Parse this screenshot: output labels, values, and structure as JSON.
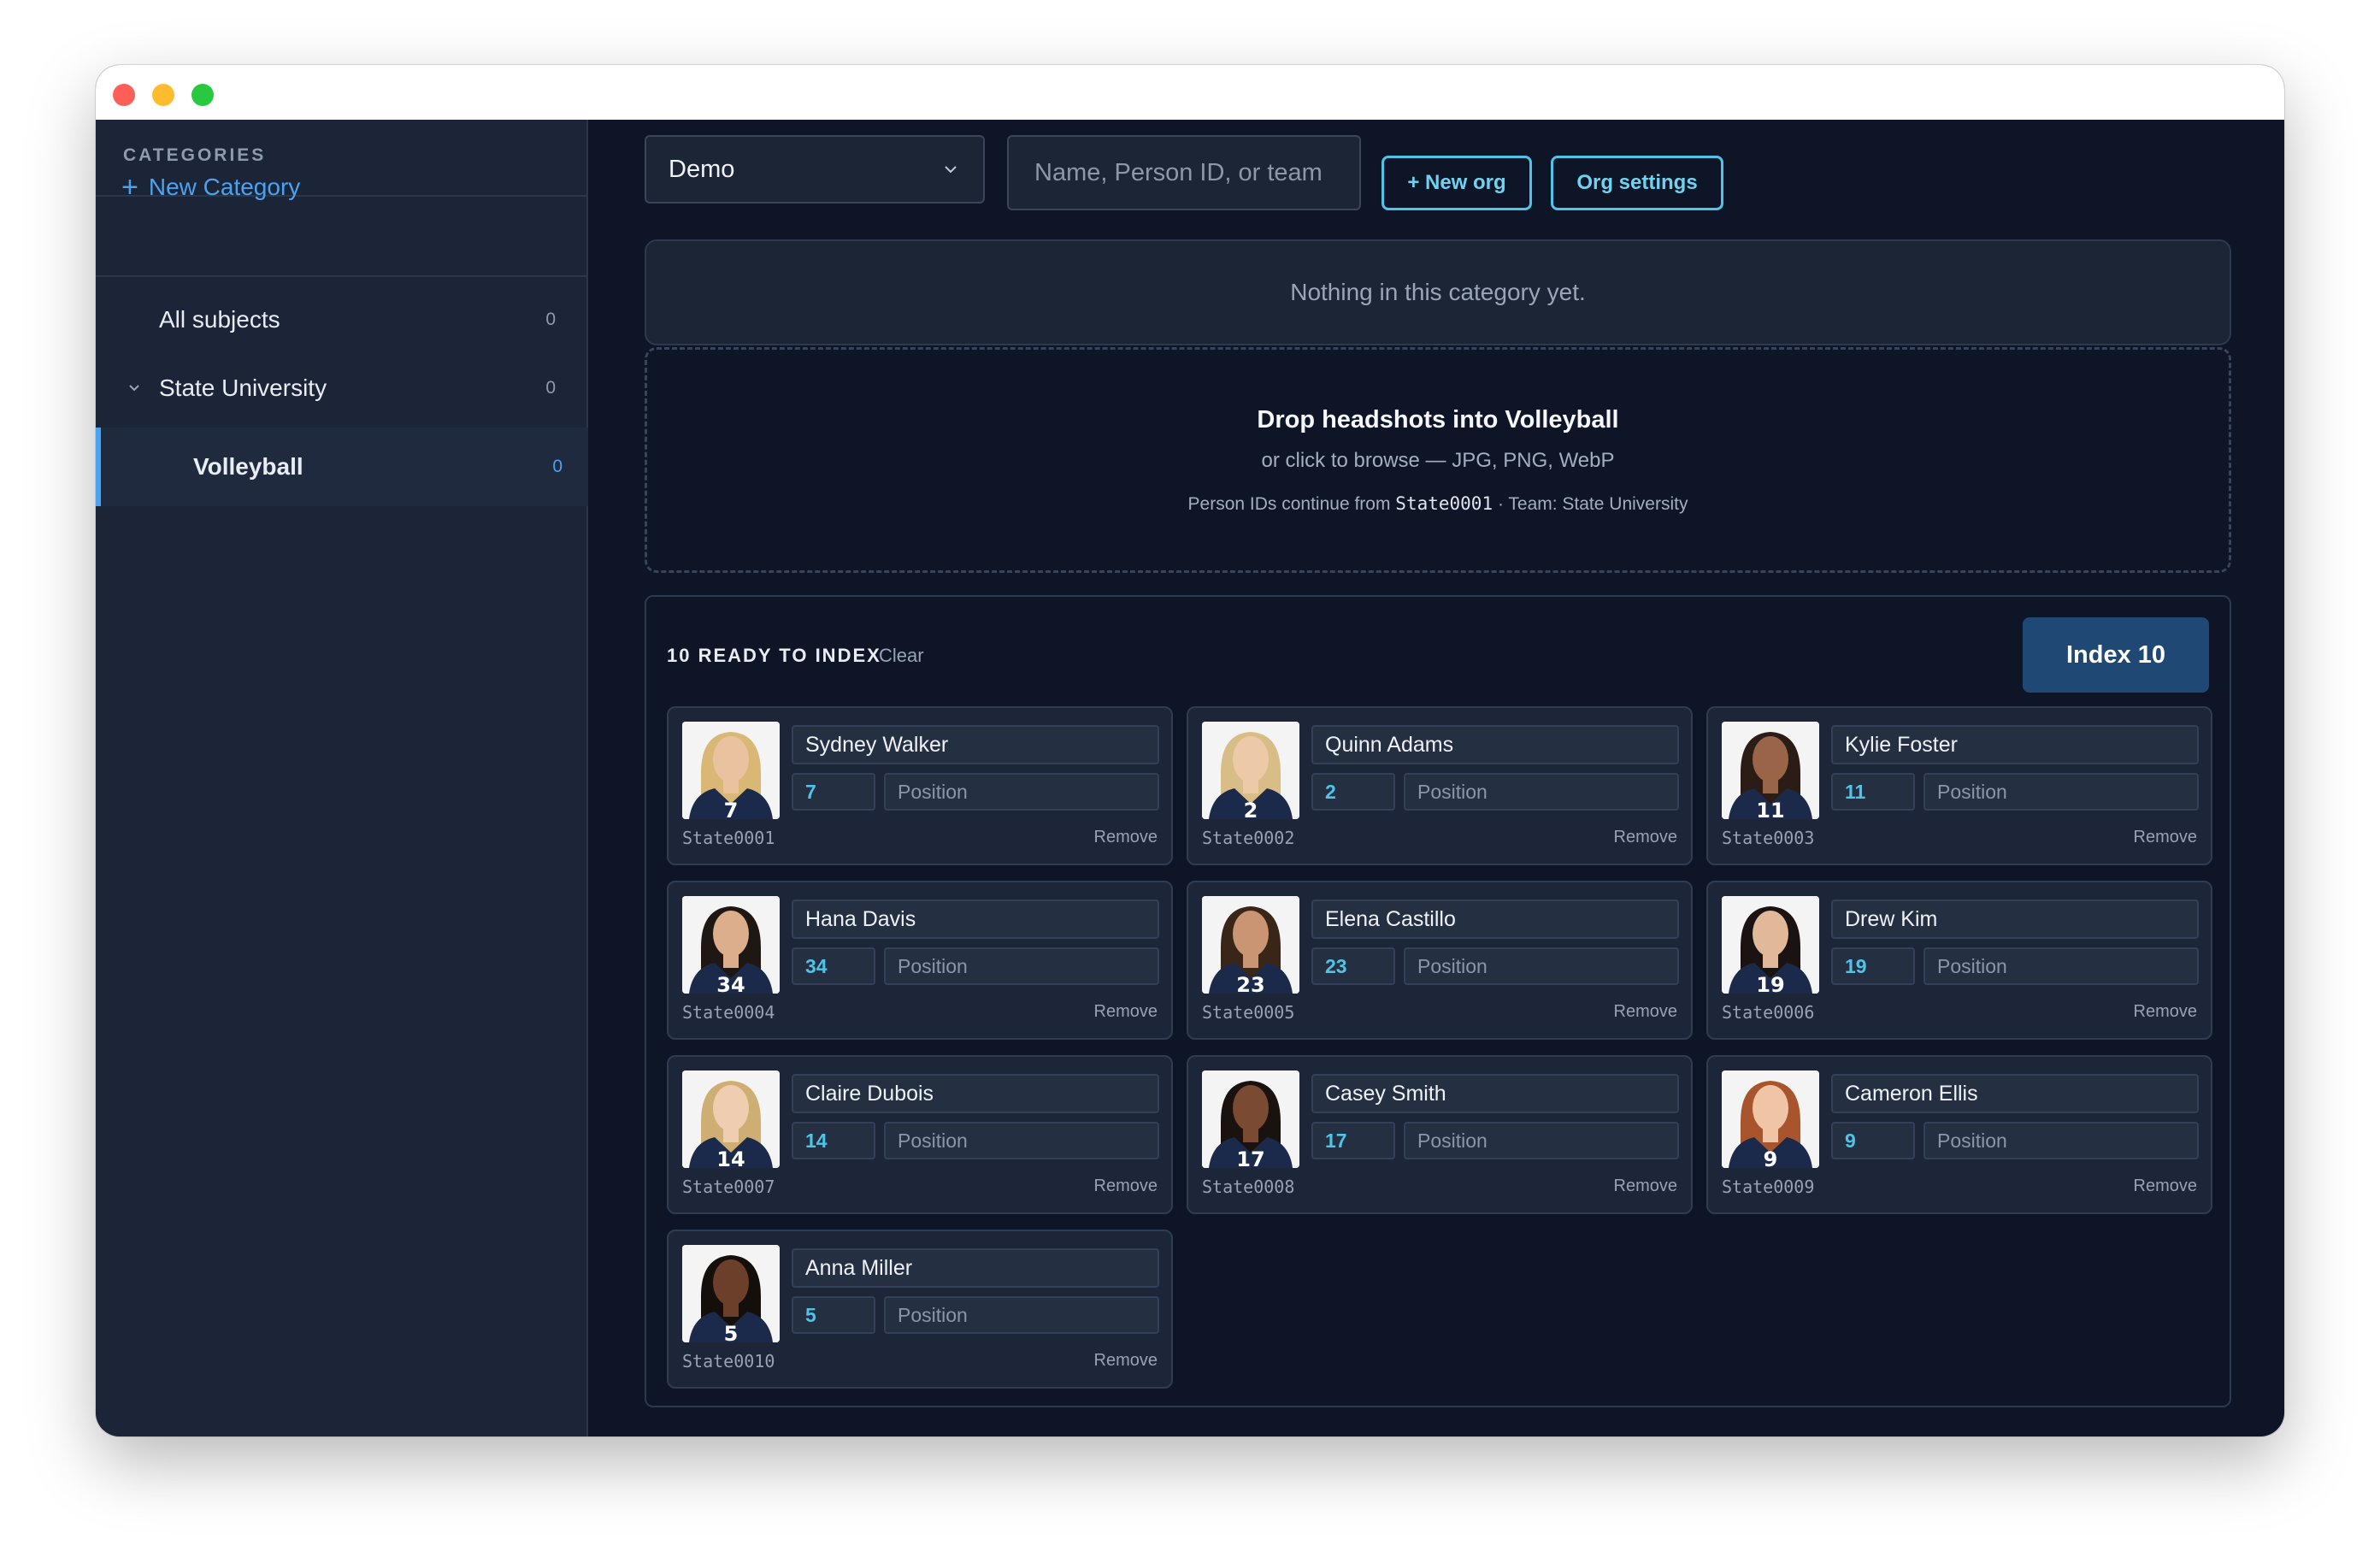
{
  "sidebar": {
    "heading": "CATEGORIES",
    "new_category": "New Category",
    "items": [
      {
        "label": "All subjects",
        "count": "0"
      },
      {
        "label": "State University",
        "count": "0"
      },
      {
        "label": "Volleyball",
        "count": "0"
      }
    ]
  },
  "toolbar": {
    "org_select": "Demo",
    "search_placeholder": "Name, Person ID, or team",
    "new_org": "+ New org",
    "org_settings": "Org settings"
  },
  "empty_message": "Nothing in this category yet.",
  "dropzone": {
    "title": "Drop headshots into Volleyball",
    "subtitle": "or click to browse — JPG, PNG, WebP",
    "info_prefix": "Person IDs continue from",
    "info_id": "State0001",
    "info_suffix": "· Team: State University"
  },
  "ready": {
    "title": "10 READY TO INDEX",
    "clear": "Clear",
    "index_button": "Index 10",
    "position_placeholder": "Position",
    "remove_label": "Remove",
    "cards": [
      {
        "name": "Sydney Walker",
        "number": "7",
        "id": "State0001",
        "hair": "#d9b774",
        "skin": "#e9c2a0"
      },
      {
        "name": "Quinn Adams",
        "number": "2",
        "id": "State0002",
        "hair": "#d8bd86",
        "skin": "#eccaa8"
      },
      {
        "name": "Kylie Foster",
        "number": "11",
        "id": "State0003",
        "hair": "#2b1c15",
        "skin": "#9a6448"
      },
      {
        "name": "Hana Davis",
        "number": "34",
        "id": "State0004",
        "hair": "#1f1713",
        "skin": "#dcae8c"
      },
      {
        "name": "Elena Castillo",
        "number": "23",
        "id": "State0005",
        "hair": "#3a2618",
        "skin": "#c99572"
      },
      {
        "name": "Drew Kim",
        "number": "19",
        "id": "State0006",
        "hair": "#1a1311",
        "skin": "#e1b998"
      },
      {
        "name": "Claire Dubois",
        "number": "14",
        "id": "State0007",
        "hair": "#cfae73",
        "skin": "#efcdb0"
      },
      {
        "name": "Casey Smith",
        "number": "17",
        "id": "State0008",
        "hair": "#1a120e",
        "skin": "#7b4a32"
      },
      {
        "name": "Cameron Ellis",
        "number": "9",
        "id": "State0009",
        "hair": "#a8552e",
        "skin": "#efc5a6"
      },
      {
        "name": "Anna Miller",
        "number": "5",
        "id": "State0010",
        "hair": "#150f0c",
        "skin": "#6c3f2a"
      }
    ]
  },
  "colors": {
    "accent": "#4aa3f0",
    "outline_button": "#4fc4e8",
    "index_button": "#204874",
    "jersey": "#1b2a4a"
  }
}
